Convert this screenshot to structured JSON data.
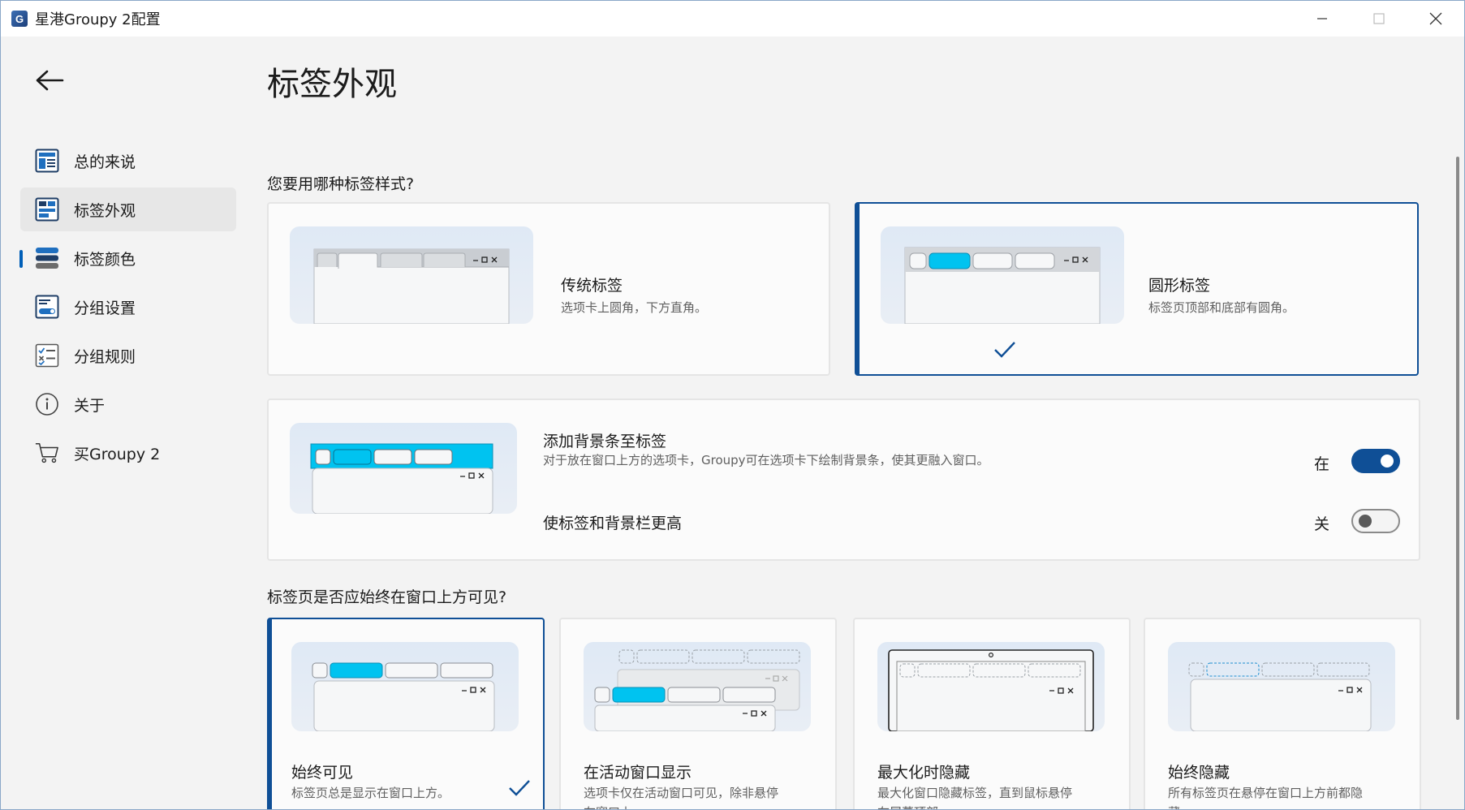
{
  "window": {
    "title": "星港Groupy 2配置",
    "app_icon_letter": "G",
    "controls": {
      "minimize_icon": "minimize-icon",
      "maximize_icon": "maximize-icon",
      "close_icon": "close-icon"
    }
  },
  "sidebar": {
    "back_icon": "arrow-left-icon",
    "items": [
      {
        "label": "总的来说",
        "icon": "general-settings-icon",
        "active": false
      },
      {
        "label": "标签外观",
        "icon": "tab-appearance-icon",
        "active": true
      },
      {
        "label": "标签颜色",
        "icon": "tab-color-icon",
        "active": false
      },
      {
        "label": "分组设置",
        "icon": "group-settings-icon",
        "active": false
      },
      {
        "label": "分组规则",
        "icon": "group-rules-icon",
        "active": false
      },
      {
        "label": "关于",
        "icon": "info-icon",
        "active": false
      },
      {
        "label": "买Groupy 2",
        "icon": "cart-icon",
        "active": false
      }
    ]
  },
  "main": {
    "title": "标签外观",
    "tab_style": {
      "question": "您要用哪种标签样式?",
      "options": [
        {
          "title": "传统标签",
          "desc": "选项卡上圆角，下方直角。",
          "selected": false
        },
        {
          "title": "圆形标签",
          "desc": "标签页顶部和底部有圆角。",
          "selected": true
        }
      ]
    },
    "background_bar": {
      "setting1_title": "添加背景条至标签",
      "setting1_desc": "对于放在窗口上方的选项卡，Groupy可在选项卡下绘制背景条，使其更融入窗口。",
      "setting1_state": "在",
      "setting1_on": true,
      "setting2_title": "使标签和背景栏更高",
      "setting2_state": "关",
      "setting2_on": false
    },
    "visibility": {
      "question": "标签页是否应始终在窗口上方可见?",
      "options": [
        {
          "title": "始终可见",
          "desc": "标签页总是显示在窗口上方。",
          "selected": true
        },
        {
          "title": "在活动窗口显示",
          "desc": "选项卡仅在活动窗口可见，除非悬停在窗口上。",
          "selected": false
        },
        {
          "title": "最大化时隐藏",
          "desc": "最大化窗口隐藏标签，直到鼠标悬停在屏幕顶部。",
          "selected": false
        },
        {
          "title": "始终隐藏",
          "desc": "所有标签页在悬停在窗口上方前都隐藏。",
          "selected": false
        }
      ]
    }
  },
  "colors": {
    "accent": "#0f4f96",
    "active_tab": "#00c3f0",
    "nav_indicator": "#005fb8"
  }
}
